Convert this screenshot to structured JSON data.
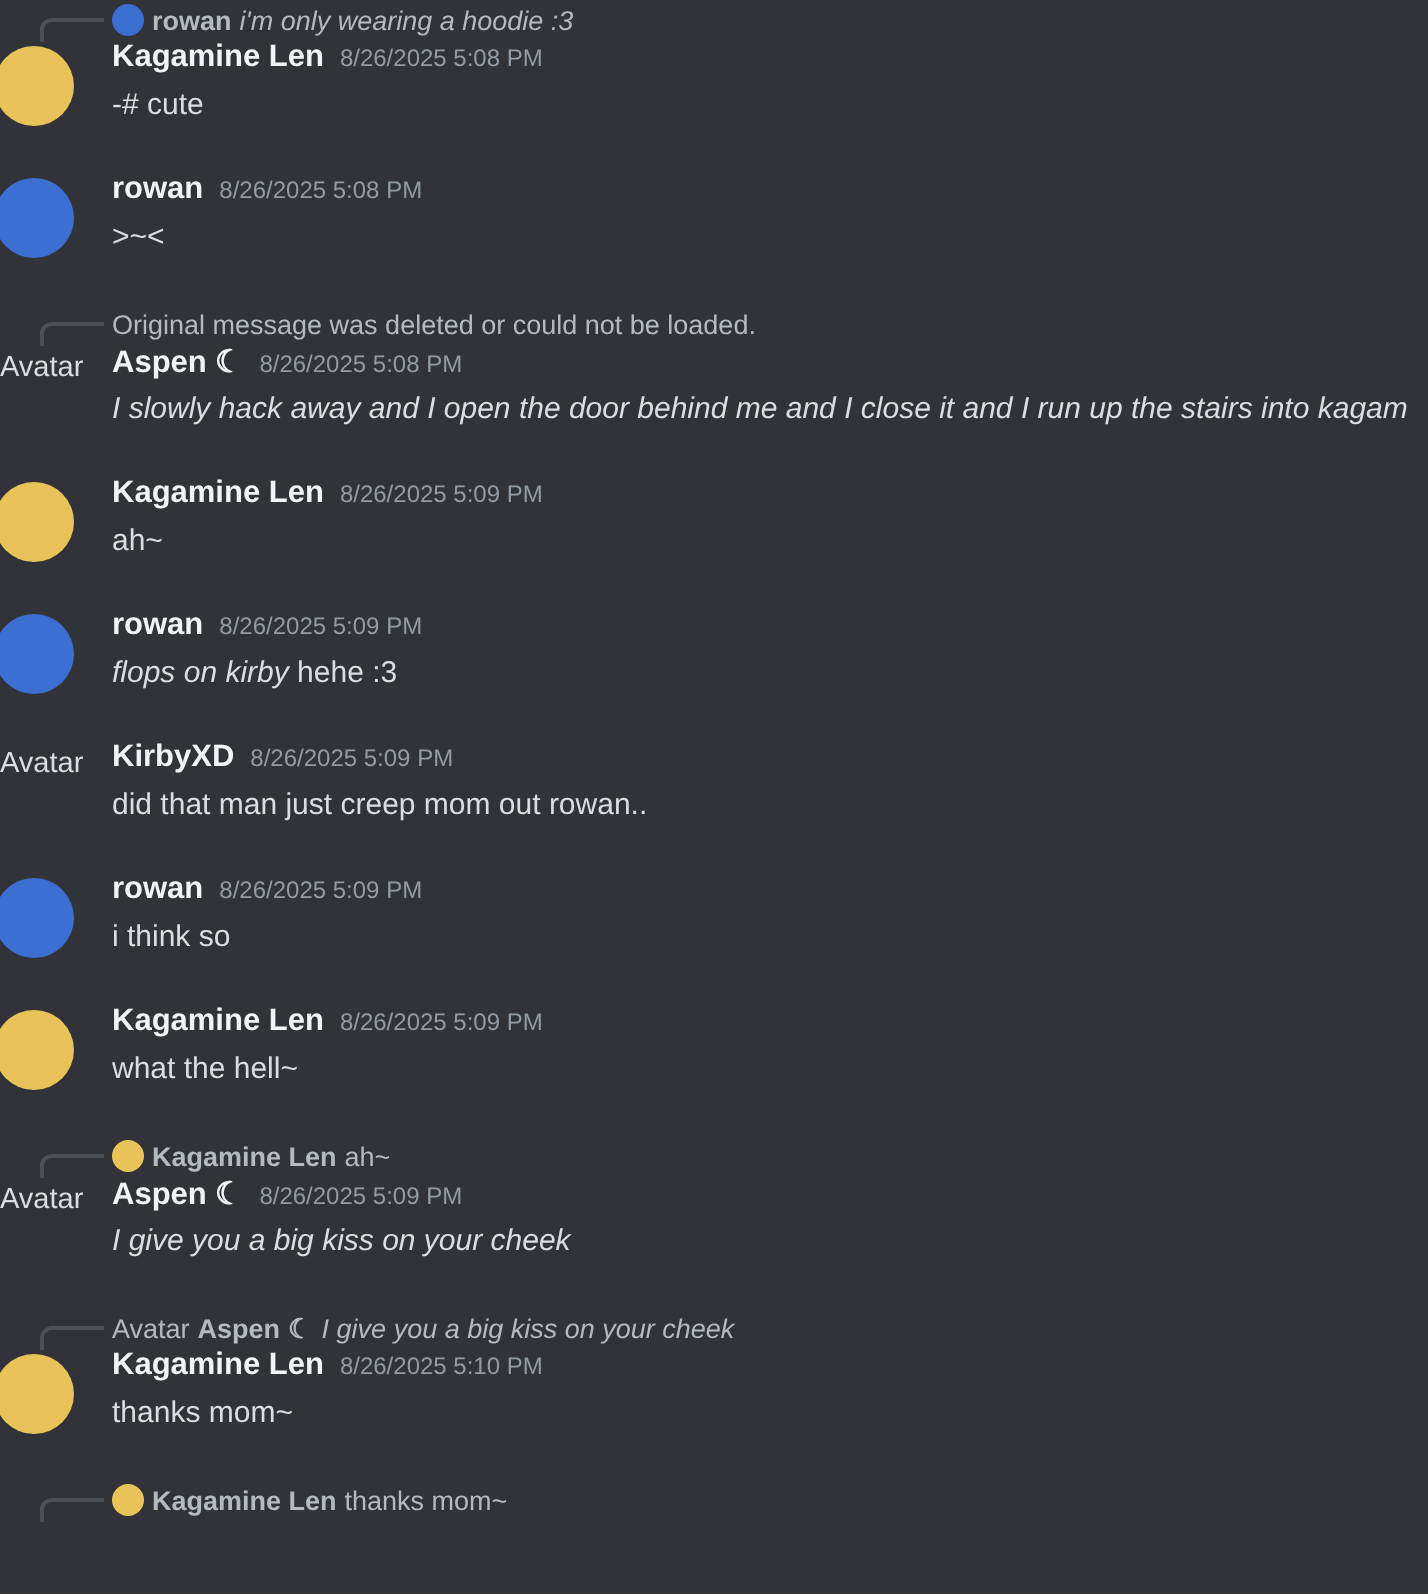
{
  "messages": [
    {
      "reply": {
        "kind": "user",
        "color": "#3b6fd1",
        "author": "rowan",
        "text": "i'm only wearing a hoodie :3",
        "italic": true
      },
      "avatar": {
        "kind": "image",
        "color": "#e9c25a"
      },
      "author": "Kagamine Len",
      "time": "8/26/2025 5:08 PM",
      "text": "-# cute",
      "italic": false
    },
    {
      "avatar": {
        "kind": "image",
        "color": "#3b6fd1"
      },
      "author": "rowan",
      "time": "8/26/2025 5:08 PM",
      "text": ">~<",
      "italic": false
    },
    {
      "reply": {
        "kind": "deleted",
        "text": "Original message was deleted or could not be loaded."
      },
      "avatar": {
        "kind": "broken",
        "alt": "Avatar"
      },
      "author": "Aspen ☾",
      "time": "8/26/2025 5:08 PM",
      "text": "I slowly hack away and I open the door behind me and I close it and I run up the stairs into kagam",
      "italic": true
    },
    {
      "avatar": {
        "kind": "image",
        "color": "#e9c25a"
      },
      "author": "Kagamine Len",
      "time": "8/26/2025 5:09 PM",
      "text": "ah~",
      "italic": false
    },
    {
      "avatar": {
        "kind": "image",
        "color": "#3b6fd1"
      },
      "author": "rowan",
      "time": "8/26/2025 5:09 PM",
      "text": "*flops on kirby* hehe :3",
      "italic": false
    },
    {
      "avatar": {
        "kind": "broken",
        "alt": "Avatar"
      },
      "author": "KirbyXD",
      "time": "8/26/2025 5:09 PM",
      "text": "did that man just creep mom out rowan..",
      "italic": false
    },
    {
      "avatar": {
        "kind": "image",
        "color": "#3b6fd1"
      },
      "author": "rowan",
      "time": "8/26/2025 5:09 PM",
      "text": "i think so",
      "italic": false
    },
    {
      "avatar": {
        "kind": "image",
        "color": "#e9c25a"
      },
      "author": "Kagamine Len",
      "time": "8/26/2025 5:09 PM",
      "text": "what the hell~",
      "italic": false
    },
    {
      "reply": {
        "kind": "user",
        "color": "#e9c25a",
        "author": "Kagamine Len",
        "text": "ah~",
        "italic": false
      },
      "avatar": {
        "kind": "broken",
        "alt": "Avatar"
      },
      "author": "Aspen ☾",
      "time": "8/26/2025 5:09 PM",
      "text": "I give you a big kiss on your cheek",
      "italic": true
    },
    {
      "reply": {
        "kind": "broken",
        "alt": "Avatar",
        "author": "Aspen ☾",
        "text": "I give you a big kiss on your cheek",
        "italic": true
      },
      "avatar": {
        "kind": "image",
        "color": "#e9c25a"
      },
      "author": "Kagamine Len",
      "time": "8/26/2025 5:10 PM",
      "text": "thanks mom~",
      "italic": false
    },
    {
      "reply": {
        "kind": "user",
        "color": "#e9c25a",
        "author": "Kagamine Len",
        "text": "thanks mom~",
        "italic": false
      }
    }
  ]
}
